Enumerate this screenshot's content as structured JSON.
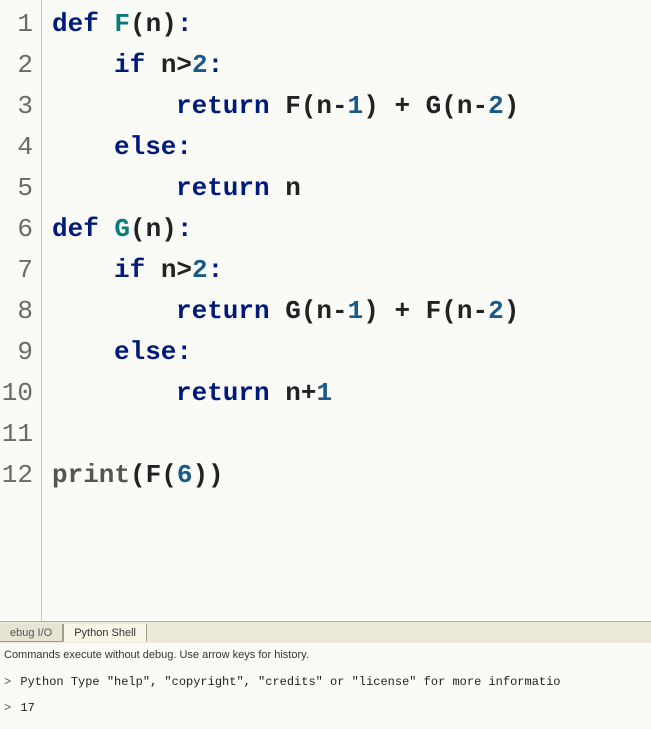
{
  "editor": {
    "lines": [
      {
        "num": "1",
        "tokens": [
          [
            "kw",
            "def "
          ],
          [
            "fn",
            "F"
          ],
          [
            "pl",
            "(n)"
          ],
          [
            "kw",
            ":"
          ]
        ]
      },
      {
        "num": "2",
        "indent": 1,
        "tokens": [
          [
            "kw",
            "if "
          ],
          [
            "pl",
            "n>"
          ],
          [
            "num",
            "2"
          ],
          [
            "kw",
            ":"
          ]
        ]
      },
      {
        "num": "3",
        "indent": 2,
        "tokens": [
          [
            "kw",
            "return "
          ],
          [
            "pl",
            "F(n-"
          ],
          [
            "num",
            "1"
          ],
          [
            "pl",
            ") + G(n-"
          ],
          [
            "num",
            "2"
          ],
          [
            "pl",
            ")"
          ]
        ]
      },
      {
        "num": "4",
        "indent": 1,
        "tokens": [
          [
            "kw",
            "else"
          ],
          [
            "kw",
            ":"
          ]
        ]
      },
      {
        "num": "5",
        "indent": 2,
        "tokens": [
          [
            "kw",
            "return "
          ],
          [
            "pl",
            "n"
          ]
        ]
      },
      {
        "num": "6",
        "tokens": [
          [
            "kw",
            "def "
          ],
          [
            "fn",
            "G"
          ],
          [
            "pl",
            "(n)"
          ],
          [
            "kw",
            ":"
          ]
        ]
      },
      {
        "num": "7",
        "indent": 1,
        "tokens": [
          [
            "kw",
            "if "
          ],
          [
            "pl",
            "n>"
          ],
          [
            "num",
            "2"
          ],
          [
            "kw",
            ":"
          ]
        ]
      },
      {
        "num": "8",
        "indent": 2,
        "tokens": [
          [
            "kw",
            "return "
          ],
          [
            "pl",
            "G(n-"
          ],
          [
            "num",
            "1"
          ],
          [
            "pl",
            ") + F(n-"
          ],
          [
            "num",
            "2"
          ],
          [
            "pl",
            ")"
          ]
        ]
      },
      {
        "num": "9",
        "indent": 1,
        "tokens": [
          [
            "kw",
            "else"
          ],
          [
            "kw",
            ":"
          ]
        ]
      },
      {
        "num": "10",
        "indent": 2,
        "tokens": [
          [
            "kw",
            "return "
          ],
          [
            "pl",
            "n+"
          ],
          [
            "num",
            "1"
          ]
        ]
      },
      {
        "num": "11",
        "tokens": []
      },
      {
        "num": "12",
        "tokens": [
          [
            "call",
            "print"
          ],
          [
            "pl",
            "(F("
          ],
          [
            "num",
            "6"
          ],
          [
            "pl",
            "))"
          ]
        ]
      }
    ]
  },
  "tabs": {
    "debug": "ebug I/O",
    "shell": "Python Shell"
  },
  "shell": {
    "hint": "Commands execute without debug.  Use arrow keys for history.",
    "banner": "Python Type \"help\", \"copyright\", \"credits\" or \"license\" for more informatio",
    "output": "17",
    "prompt": ">"
  }
}
